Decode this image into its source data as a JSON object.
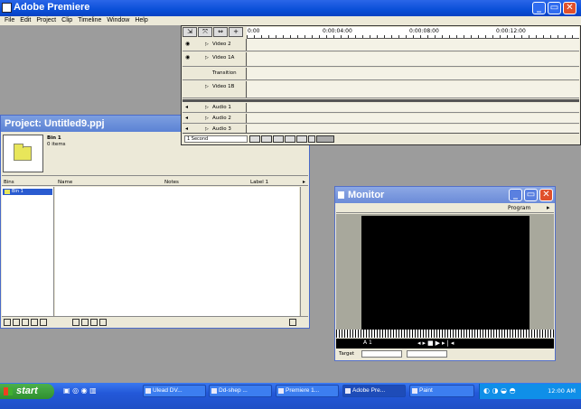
{
  "app": {
    "title": "Adobe Premiere"
  },
  "menu": [
    "File",
    "Edit",
    "Project",
    "Clip",
    "Timeline",
    "Window",
    "Help"
  ],
  "timeline": {
    "ruler_labels": [
      "0:00",
      "0:00:04:00",
      "0:00:08:00",
      "0:00:12:00"
    ],
    "tracks": [
      {
        "name": "Video 2",
        "icon": "eye-icon"
      },
      {
        "name": "Video 1A",
        "icon": "eye-icon"
      },
      {
        "name": "Transition",
        "icon": ""
      },
      {
        "name": "Video 1B",
        "icon": ""
      },
      {
        "name": "Audio 1",
        "icon": "speaker-icon"
      },
      {
        "name": "Audio 2",
        "icon": "speaker-icon"
      },
      {
        "name": "Audio 3",
        "icon": "speaker-icon"
      }
    ],
    "zoom_value": "1 Second"
  },
  "project": {
    "title": "Project: Untitled9.ppj",
    "bin_name": "Bin 1",
    "bin_count": "0 items",
    "columns": [
      "Bins",
      "Name",
      "Notes",
      "Label 1"
    ],
    "bins": [
      "Bin 1"
    ]
  },
  "monitor": {
    "title": "Monitor",
    "view_label": "Program",
    "timecode": "A 1",
    "target_label": "Target"
  },
  "taskbar": {
    "start_label": "start",
    "tasks": [
      "Ulead DV...",
      "Dd-shep ...",
      "Premiere 1...",
      "Adobe Pre...",
      "Paint"
    ],
    "clock": "12:00 AM"
  },
  "colors": {
    "title_blue": "#0a4fd8",
    "inactive_title": "#5b82d4",
    "taskbar": "#2358d8",
    "start_green": "#2f8f2f"
  }
}
